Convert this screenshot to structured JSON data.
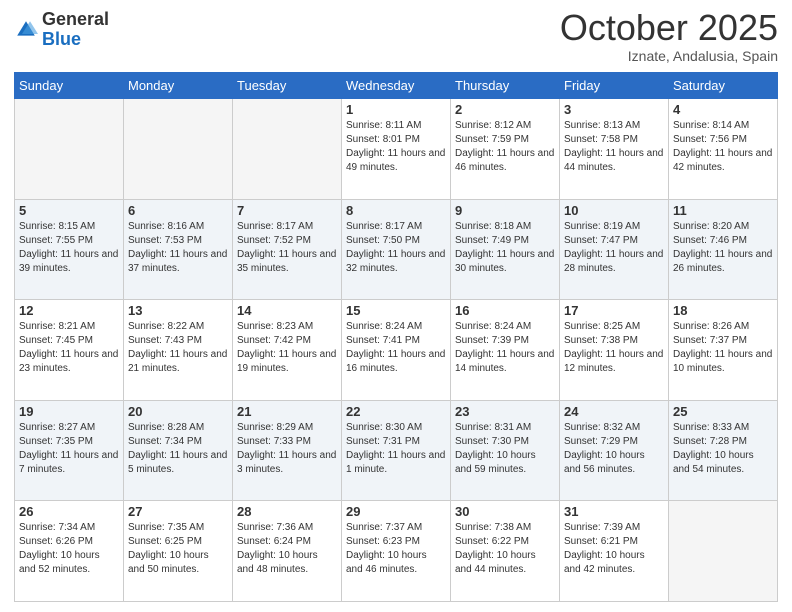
{
  "header": {
    "logo_general": "General",
    "logo_blue": "Blue",
    "month_title": "October 2025",
    "location": "Iznate, Andalusia, Spain"
  },
  "days_of_week": [
    "Sunday",
    "Monday",
    "Tuesday",
    "Wednesday",
    "Thursday",
    "Friday",
    "Saturday"
  ],
  "weeks": [
    [
      {
        "day": "",
        "sunrise": "",
        "sunset": "",
        "daylight": "",
        "empty": true
      },
      {
        "day": "",
        "sunrise": "",
        "sunset": "",
        "daylight": "",
        "empty": true
      },
      {
        "day": "",
        "sunrise": "",
        "sunset": "",
        "daylight": "",
        "empty": true
      },
      {
        "day": "1",
        "sunrise": "Sunrise: 8:11 AM",
        "sunset": "Sunset: 8:01 PM",
        "daylight": "Daylight: 11 hours and 49 minutes."
      },
      {
        "day": "2",
        "sunrise": "Sunrise: 8:12 AM",
        "sunset": "Sunset: 7:59 PM",
        "daylight": "Daylight: 11 hours and 46 minutes."
      },
      {
        "day": "3",
        "sunrise": "Sunrise: 8:13 AM",
        "sunset": "Sunset: 7:58 PM",
        "daylight": "Daylight: 11 hours and 44 minutes."
      },
      {
        "day": "4",
        "sunrise": "Sunrise: 8:14 AM",
        "sunset": "Sunset: 7:56 PM",
        "daylight": "Daylight: 11 hours and 42 minutes."
      }
    ],
    [
      {
        "day": "5",
        "sunrise": "Sunrise: 8:15 AM",
        "sunset": "Sunset: 7:55 PM",
        "daylight": "Daylight: 11 hours and 39 minutes."
      },
      {
        "day": "6",
        "sunrise": "Sunrise: 8:16 AM",
        "sunset": "Sunset: 7:53 PM",
        "daylight": "Daylight: 11 hours and 37 minutes."
      },
      {
        "day": "7",
        "sunrise": "Sunrise: 8:17 AM",
        "sunset": "Sunset: 7:52 PM",
        "daylight": "Daylight: 11 hours and 35 minutes."
      },
      {
        "day": "8",
        "sunrise": "Sunrise: 8:17 AM",
        "sunset": "Sunset: 7:50 PM",
        "daylight": "Daylight: 11 hours and 32 minutes."
      },
      {
        "day": "9",
        "sunrise": "Sunrise: 8:18 AM",
        "sunset": "Sunset: 7:49 PM",
        "daylight": "Daylight: 11 hours and 30 minutes."
      },
      {
        "day": "10",
        "sunrise": "Sunrise: 8:19 AM",
        "sunset": "Sunset: 7:47 PM",
        "daylight": "Daylight: 11 hours and 28 minutes."
      },
      {
        "day": "11",
        "sunrise": "Sunrise: 8:20 AM",
        "sunset": "Sunset: 7:46 PM",
        "daylight": "Daylight: 11 hours and 26 minutes."
      }
    ],
    [
      {
        "day": "12",
        "sunrise": "Sunrise: 8:21 AM",
        "sunset": "Sunset: 7:45 PM",
        "daylight": "Daylight: 11 hours and 23 minutes."
      },
      {
        "day": "13",
        "sunrise": "Sunrise: 8:22 AM",
        "sunset": "Sunset: 7:43 PM",
        "daylight": "Daylight: 11 hours and 21 minutes."
      },
      {
        "day": "14",
        "sunrise": "Sunrise: 8:23 AM",
        "sunset": "Sunset: 7:42 PM",
        "daylight": "Daylight: 11 hours and 19 minutes."
      },
      {
        "day": "15",
        "sunrise": "Sunrise: 8:24 AM",
        "sunset": "Sunset: 7:41 PM",
        "daylight": "Daylight: 11 hours and 16 minutes."
      },
      {
        "day": "16",
        "sunrise": "Sunrise: 8:24 AM",
        "sunset": "Sunset: 7:39 PM",
        "daylight": "Daylight: 11 hours and 14 minutes."
      },
      {
        "day": "17",
        "sunrise": "Sunrise: 8:25 AM",
        "sunset": "Sunset: 7:38 PM",
        "daylight": "Daylight: 11 hours and 12 minutes."
      },
      {
        "day": "18",
        "sunrise": "Sunrise: 8:26 AM",
        "sunset": "Sunset: 7:37 PM",
        "daylight": "Daylight: 11 hours and 10 minutes."
      }
    ],
    [
      {
        "day": "19",
        "sunrise": "Sunrise: 8:27 AM",
        "sunset": "Sunset: 7:35 PM",
        "daylight": "Daylight: 11 hours and 7 minutes."
      },
      {
        "day": "20",
        "sunrise": "Sunrise: 8:28 AM",
        "sunset": "Sunset: 7:34 PM",
        "daylight": "Daylight: 11 hours and 5 minutes."
      },
      {
        "day": "21",
        "sunrise": "Sunrise: 8:29 AM",
        "sunset": "Sunset: 7:33 PM",
        "daylight": "Daylight: 11 hours and 3 minutes."
      },
      {
        "day": "22",
        "sunrise": "Sunrise: 8:30 AM",
        "sunset": "Sunset: 7:31 PM",
        "daylight": "Daylight: 11 hours and 1 minute."
      },
      {
        "day": "23",
        "sunrise": "Sunrise: 8:31 AM",
        "sunset": "Sunset: 7:30 PM",
        "daylight": "Daylight: 10 hours and 59 minutes."
      },
      {
        "day": "24",
        "sunrise": "Sunrise: 8:32 AM",
        "sunset": "Sunset: 7:29 PM",
        "daylight": "Daylight: 10 hours and 56 minutes."
      },
      {
        "day": "25",
        "sunrise": "Sunrise: 8:33 AM",
        "sunset": "Sunset: 7:28 PM",
        "daylight": "Daylight: 10 hours and 54 minutes."
      }
    ],
    [
      {
        "day": "26",
        "sunrise": "Sunrise: 7:34 AM",
        "sunset": "Sunset: 6:26 PM",
        "daylight": "Daylight: 10 hours and 52 minutes."
      },
      {
        "day": "27",
        "sunrise": "Sunrise: 7:35 AM",
        "sunset": "Sunset: 6:25 PM",
        "daylight": "Daylight: 10 hours and 50 minutes."
      },
      {
        "day": "28",
        "sunrise": "Sunrise: 7:36 AM",
        "sunset": "Sunset: 6:24 PM",
        "daylight": "Daylight: 10 hours and 48 minutes."
      },
      {
        "day": "29",
        "sunrise": "Sunrise: 7:37 AM",
        "sunset": "Sunset: 6:23 PM",
        "daylight": "Daylight: 10 hours and 46 minutes."
      },
      {
        "day": "30",
        "sunrise": "Sunrise: 7:38 AM",
        "sunset": "Sunset: 6:22 PM",
        "daylight": "Daylight: 10 hours and 44 minutes."
      },
      {
        "day": "31",
        "sunrise": "Sunrise: 7:39 AM",
        "sunset": "Sunset: 6:21 PM",
        "daylight": "Daylight: 10 hours and 42 minutes."
      },
      {
        "day": "",
        "sunrise": "",
        "sunset": "",
        "daylight": "",
        "empty": true
      }
    ]
  ]
}
